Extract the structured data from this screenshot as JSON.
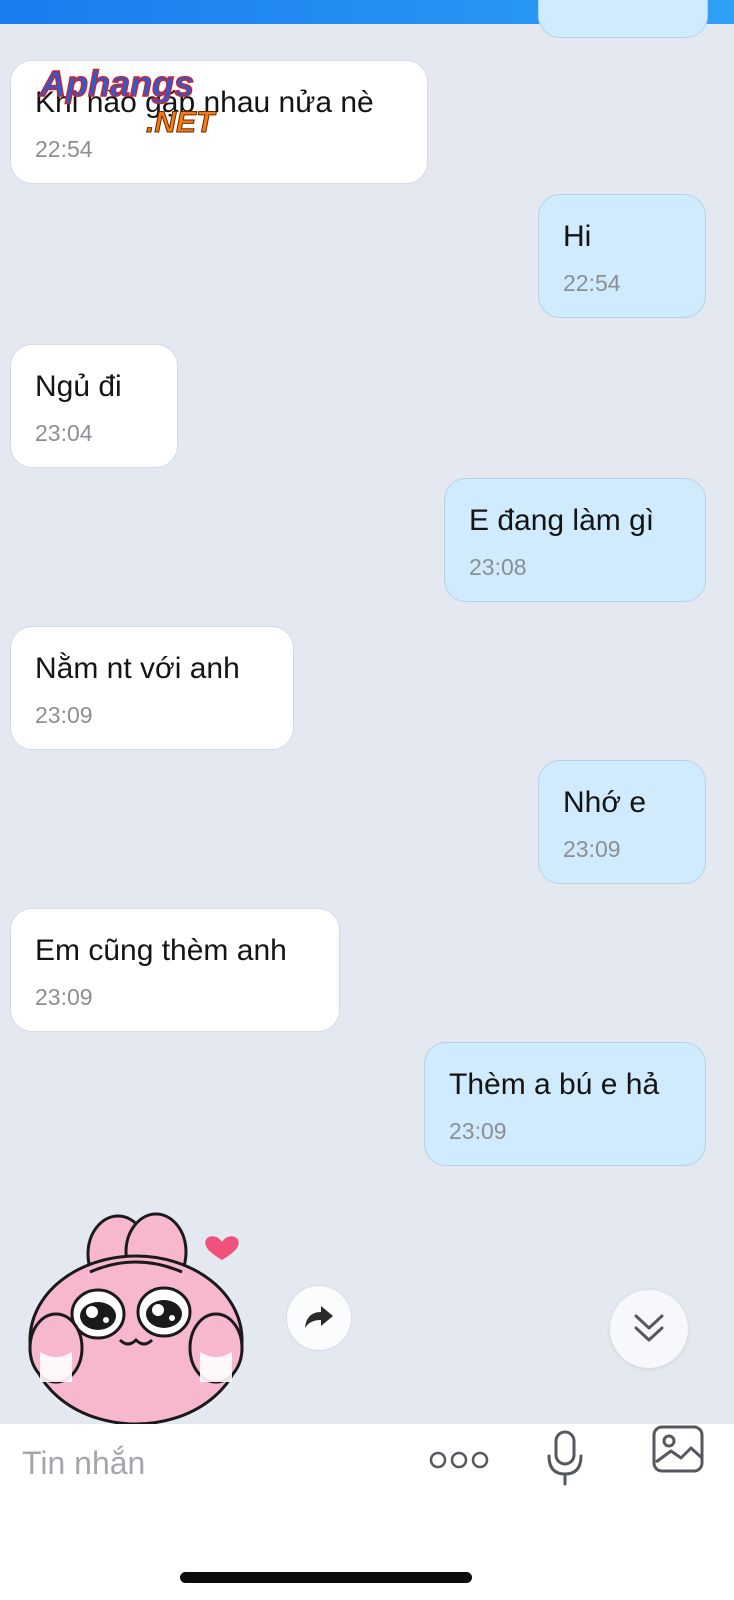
{
  "watermark": {
    "brand_text": "Aphangs",
    "brand_suffix": ".NET"
  },
  "messages": [
    {
      "side": "in",
      "text": "Khi nào gặp nhau nửa nè",
      "time": "22:54"
    },
    {
      "side": "out",
      "text": "Hi",
      "time": "22:54"
    },
    {
      "side": "in",
      "text": "Ngủ đi",
      "time": "23:04"
    },
    {
      "side": "out",
      "text": "E đang làm gì",
      "time": "23:08"
    },
    {
      "side": "in",
      "text": "Nằm nt với anh",
      "time": "23:09"
    },
    {
      "side": "out",
      "text": "Nhớ e",
      "time": "23:09"
    },
    {
      "side": "in",
      "text": "Em cũng thèm anh",
      "time": "23:09"
    },
    {
      "side": "out",
      "text": "Thèm a bú e hả",
      "time": "23:09"
    }
  ],
  "composer": {
    "placeholder": "Tin nhắn",
    "icons": [
      "more-options-icon",
      "microphone-icon",
      "image-icon"
    ]
  },
  "colors": {
    "background": "#e3e8f1",
    "incoming_bubble": "#ffffff",
    "outgoing_bubble": "#cfebfd",
    "top_bar": "#1a7cf0",
    "timestamp": "#8c8f94",
    "sticker_pink": "#f7b8cf"
  }
}
